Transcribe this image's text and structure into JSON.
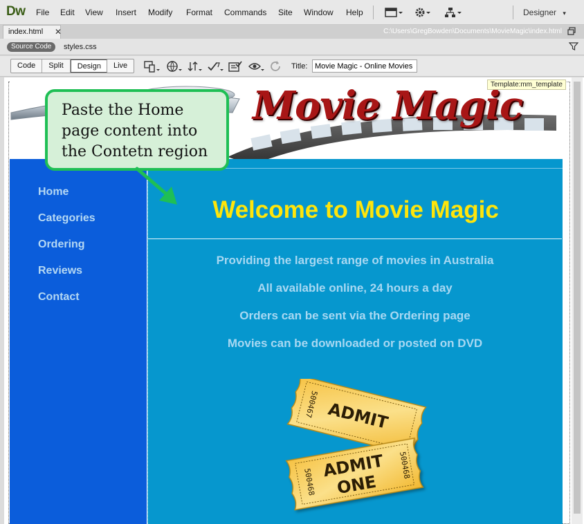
{
  "app": {
    "logo": "Dw",
    "menu": [
      "File",
      "Edit",
      "View",
      "Insert",
      "Modify",
      "Format",
      "Commands",
      "Site",
      "Window",
      "Help"
    ],
    "workspace": "Designer"
  },
  "document": {
    "tab_label": "index.html",
    "path": "C:\\Users\\GregBowden\\Documents\\MovieMagic\\index.html",
    "source_code_label": "Source Code",
    "related_file": "styles.css"
  },
  "toolbar": {
    "views": [
      "Code",
      "Split",
      "Design"
    ],
    "active_view": "Design",
    "live_label": "Live",
    "title_label": "Title:",
    "title_value": "Movie Magic - Online Movies"
  },
  "page": {
    "template_tag": "Template:mm_template",
    "logo_text": "Movie Magic",
    "nav": [
      "Home",
      "Categories",
      "Ordering",
      "Reviews",
      "Contact"
    ],
    "welcome": "Welcome to Movie Magic",
    "paragraphs": [
      "Providing the largest range of movies in Australia",
      "All available online, 24 hours a day",
      "Orders can be sent via the Ordering page",
      "Movies can be downloaded or posted on DVD"
    ],
    "tickets": {
      "line1": "ADMIT",
      "line2": "ONE",
      "number_back": "500467",
      "number_front": "500468"
    }
  },
  "callout": {
    "lines": [
      "Paste the Home",
      "page content into",
      "the Contetn region"
    ]
  }
}
